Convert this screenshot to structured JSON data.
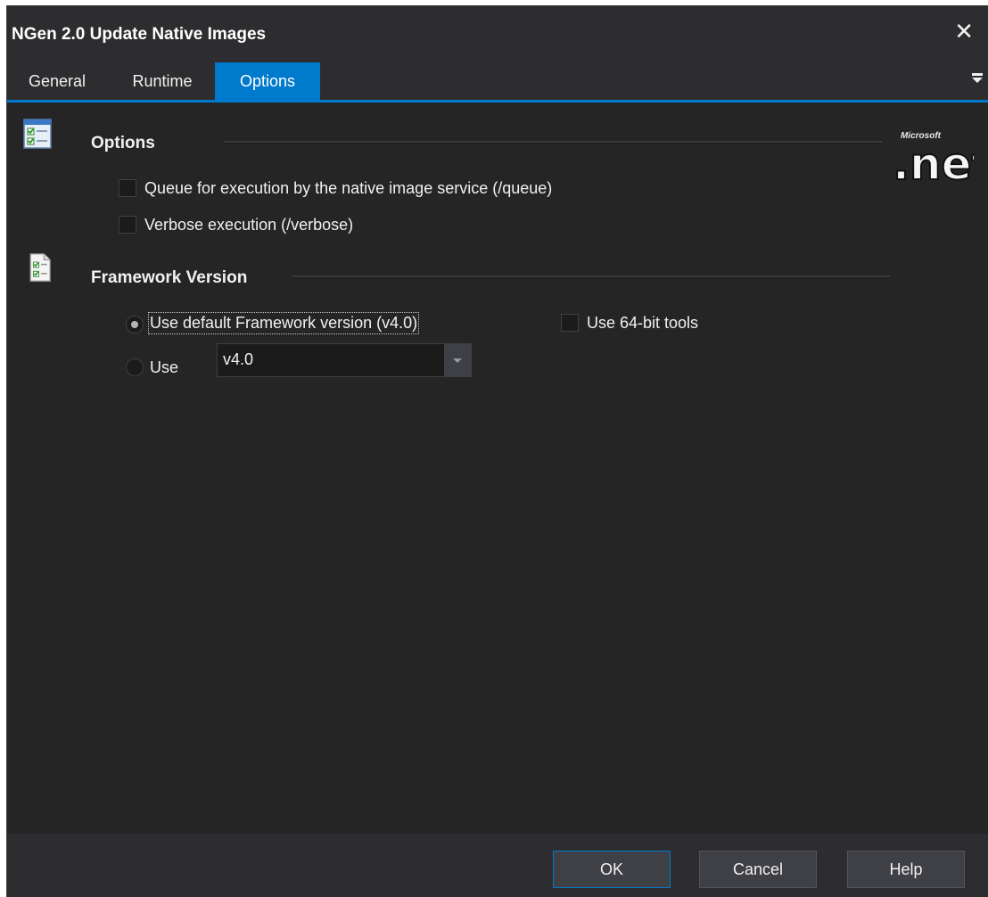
{
  "window": {
    "title": "NGen 2.0 Update Native Images",
    "close_glyph": "✕"
  },
  "tabs": [
    {
      "label": "General",
      "active": false
    },
    {
      "label": "Runtime",
      "active": false
    },
    {
      "label": "Options",
      "active": true
    }
  ],
  "options_section": {
    "title": "Options",
    "icon": "checklist-icon",
    "checkboxes": [
      {
        "label": "Queue for execution by the native image service (/queue)",
        "checked": false
      },
      {
        "label": "Verbose execution (/verbose)",
        "checked": false
      }
    ]
  },
  "framework_section": {
    "title": "Framework Version",
    "icon": "checklist-document-icon",
    "radio_default": {
      "label": "Use default Framework version (v4.0)",
      "selected": true
    },
    "radio_use": {
      "label": "Use",
      "selected": false
    },
    "version_combo": {
      "value": "v4.0"
    },
    "use_64bit": {
      "label": "Use 64-bit tools",
      "checked": false
    }
  },
  "logo": {
    "icon": "microsoft-dotnet-logo",
    "brand_text": "Microsoft",
    "text": ".net"
  },
  "footer": {
    "ok": "OK",
    "cancel": "Cancel",
    "help": "Help"
  },
  "colors": {
    "accent": "#007acc",
    "background": "#252526",
    "chrome": "#2d2d30",
    "text": "#f1f1f1"
  }
}
